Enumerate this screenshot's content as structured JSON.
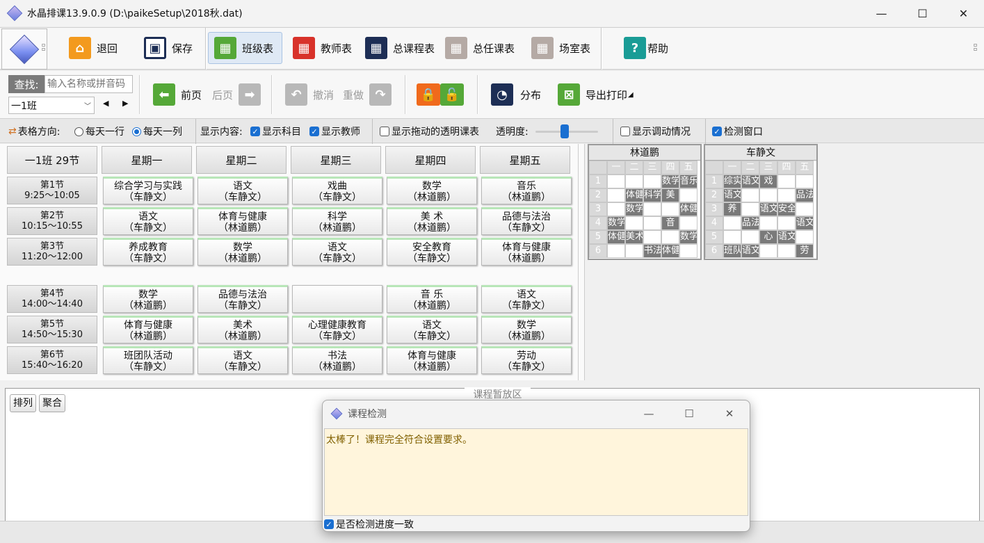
{
  "window": {
    "title": "水晶排课13.9.0.9    (D:\\paikeSetup\\2018秋.dat)",
    "minimize": "—",
    "maximize": "☐",
    "close": "✕"
  },
  "toolbar1": {
    "back": "退回",
    "save": "保存",
    "class_table": "班级表",
    "teacher_table": "教师表",
    "total_course_table": "总课程表",
    "total_assign_table": "总任课表",
    "room_table": "场室表",
    "help": "帮助"
  },
  "toolbar2": {
    "search_label": "查找:",
    "search_placeholder": "输入名称或拼音码",
    "class_selected": "一1班",
    "prev_page": "前页",
    "next_page": "后页",
    "undo": "撤消",
    "redo": "重做",
    "distribution": "分布",
    "export_print": "导出打印"
  },
  "options": {
    "direction_label": "表格方向:",
    "row_per_day": "每天一行",
    "col_per_day": "每天一列",
    "display_label": "显示内容:",
    "show_subject": "显示科目",
    "show_teacher": "显示教师",
    "show_transparent": "显示拖动的透明课表",
    "opacity_label": "透明度:",
    "show_adjust": "显示调动情况",
    "check_window": "检测窗口"
  },
  "timetable": {
    "corner": "一1班 29节",
    "days": [
      "星期一",
      "星期二",
      "星期三",
      "星期四",
      "星期五"
    ],
    "periods": [
      {
        "name": "第1节",
        "time": "9:25～10:05"
      },
      {
        "name": "第2节",
        "time": "10:15～10:55"
      },
      {
        "name": "第3节",
        "time": "11:20～12:00"
      },
      {
        "name": "第4节",
        "time": "14:00～14:40"
      },
      {
        "name": "第5节",
        "time": "14:50～15:30"
      },
      {
        "name": "第6节",
        "time": "15:40～16:20"
      }
    ],
    "cells": [
      [
        {
          "s": "综合学习与实践",
          "t": "（车静文）"
        },
        {
          "s": "语文",
          "t": "（车静文）"
        },
        {
          "s": "戏曲",
          "t": "（车静文）"
        },
        {
          "s": "数学",
          "t": "（林道鹏）"
        },
        {
          "s": "音乐",
          "t": "（林道鹏）"
        }
      ],
      [
        {
          "s": "语文",
          "t": "（车静文）"
        },
        {
          "s": "体育与健康",
          "t": "（林道鹏）"
        },
        {
          "s": "科学",
          "t": "（林道鹏）"
        },
        {
          "s": "美 术",
          "t": "（林道鹏）"
        },
        {
          "s": "品德与法治",
          "t": "（车静文）"
        }
      ],
      [
        {
          "s": "养成教育",
          "t": "（车静文）"
        },
        {
          "s": "数学",
          "t": "（林道鹏）"
        },
        {
          "s": "语文",
          "t": "（车静文）"
        },
        {
          "s": "安全教育",
          "t": "（车静文）"
        },
        {
          "s": "体育与健康",
          "t": "（林道鹏）"
        }
      ],
      [
        {
          "s": "数学",
          "t": "（林道鹏）"
        },
        {
          "s": "品德与法治",
          "t": "（车静文）"
        },
        {
          "s": "",
          "t": ""
        },
        {
          "s": "音 乐",
          "t": "（林道鹏）"
        },
        {
          "s": "语文",
          "t": "（车静文）"
        }
      ],
      [
        {
          "s": "体育与健康",
          "t": "（林道鹏）"
        },
        {
          "s": "美术",
          "t": "（林道鹏）"
        },
        {
          "s": "心理健康教育",
          "t": "（车静文）"
        },
        {
          "s": "语文",
          "t": "（车静文）"
        },
        {
          "s": "数学",
          "t": "（林道鹏）"
        }
      ],
      [
        {
          "s": "班团队活动",
          "t": "（车静文）"
        },
        {
          "s": "语文",
          "t": "（车静文）"
        },
        {
          "s": "书法",
          "t": "（林道鹏）"
        },
        {
          "s": "体育与健康",
          "t": "（林道鹏）"
        },
        {
          "s": "劳动",
          "t": "（车静文）"
        }
      ]
    ]
  },
  "mini_tables": [
    {
      "name": "林道鹏",
      "days": [
        "一",
        "二",
        "三",
        "四",
        "五"
      ],
      "rows": [
        [
          "1",
          "",
          "",
          "",
          "数学",
          "音乐"
        ],
        [
          "2",
          "",
          "体健",
          "科学",
          "美",
          ""
        ],
        [
          "3",
          "",
          "数学",
          "",
          "",
          "体健"
        ],
        [
          "4",
          "数学",
          "",
          "",
          "音",
          ""
        ],
        [
          "5",
          "体健",
          "美术",
          "",
          "",
          "数学"
        ],
        [
          "6",
          "",
          "",
          "书法",
          "体健",
          ""
        ]
      ]
    },
    {
      "name": "车静文",
      "days": [
        "一",
        "二",
        "三",
        "四",
        "五"
      ],
      "rows": [
        [
          "1",
          "综实",
          "语文",
          "戏",
          "",
          ""
        ],
        [
          "2",
          "语文",
          "",
          "",
          "",
          "品法"
        ],
        [
          "3",
          "养",
          "",
          "语文",
          "安全",
          ""
        ],
        [
          "4",
          "",
          "品法",
          "",
          "",
          "语文"
        ],
        [
          "5",
          "",
          "",
          "心",
          "语文",
          ""
        ],
        [
          "6",
          "班队",
          "语文",
          "",
          "",
          "劳"
        ]
      ]
    }
  ],
  "bottom": {
    "arrange": "排列",
    "aggregate": "聚合",
    "temp_area": "课程暂放区"
  },
  "dialog": {
    "title": "课程检测",
    "message": "太棒了！课程完全符合设置要求。",
    "check_progress": "是否检测进度一致"
  },
  "colors": {
    "accent": "#1a6fd1",
    "dialog_bg": "#fff5dc",
    "dialog_text": "#806000"
  }
}
